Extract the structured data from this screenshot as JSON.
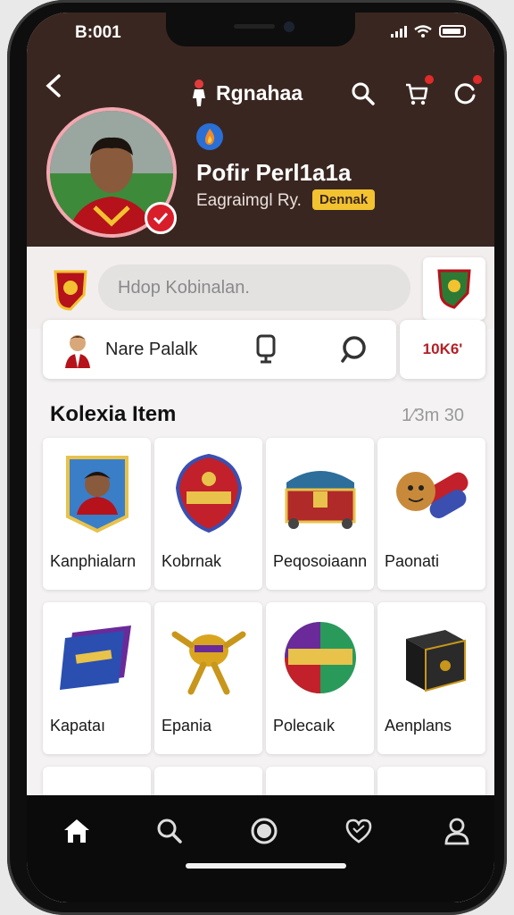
{
  "status": {
    "time": "B:001"
  },
  "header": {
    "app_name": "Rgnahaa"
  },
  "profile": {
    "name": "Pofir Perl1a1a",
    "subtitle": "Eagraimgl Ry.",
    "tag": "Dennak"
  },
  "search": {
    "placeholder": "Hdop Kobinalan."
  },
  "player": {
    "name": "Nare Palalk",
    "score": "10K6'"
  },
  "collection": {
    "title": "Kolexia Item",
    "meta": "1⁄3m 30",
    "items": [
      {
        "label": "Kanphialarn",
        "icon": "player-card-icon"
      },
      {
        "label": "Kobrnak",
        "icon": "crest-shield-icon"
      },
      {
        "label": "Peqosoiaann",
        "icon": "treasure-chest-icon"
      },
      {
        "label": "Paonati",
        "icon": "lion-cannon-icon"
      },
      {
        "label": "Kapataı",
        "icon": "card-pack-icon"
      },
      {
        "label": "Epania",
        "icon": "golden-key-icon"
      },
      {
        "label": "Polecaık",
        "icon": "ball-badge-icon"
      },
      {
        "label": "Aenplans",
        "icon": "black-box-icon"
      }
    ]
  },
  "nav": [
    "home-icon",
    "search-icon",
    "record-icon",
    "heart-icon",
    "profile-icon"
  ],
  "colors": {
    "header_bg": "#3a2620",
    "accent_red": "#d81e2a",
    "tag_yellow": "#f2c230"
  }
}
